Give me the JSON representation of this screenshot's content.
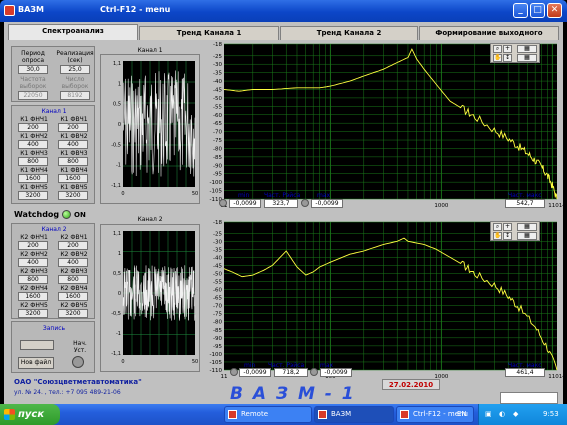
{
  "window": {
    "app_title": "ВАЗМ",
    "menu_text": "Ctrl-F12 - menu",
    "minimize": "_",
    "maximize": "□",
    "close": "✕"
  },
  "tabs": [
    {
      "label": "Спектроанализ",
      "active": true
    },
    {
      "label": "Тренд Канала 1",
      "active": false
    },
    {
      "label": "Тренд Канала 2",
      "active": false
    },
    {
      "label": "Формирование выходного сигнала",
      "active": false
    }
  ],
  "params": {
    "period_label": "Период опроса",
    "period_value": "30,0",
    "realization_label": "Реализация (сек)",
    "realization_value": "25,0",
    "freq_label": "Частота выборок",
    "freq_value": "22050",
    "count_label": "Число выборок",
    "count_value": "8192"
  },
  "channel1": {
    "title": "Канал 1",
    "filters": [
      {
        "label": "К1 ФНЧ1",
        "value": "200"
      },
      {
        "label": "К1 ФВЧ1",
        "value": "200"
      },
      {
        "label": "К1 ФНЧ2",
        "value": "400"
      },
      {
        "label": "К1 ФВЧ2",
        "value": "400"
      },
      {
        "label": "К1 ФНЧ3",
        "value": "800"
      },
      {
        "label": "К1 ФВЧ3",
        "value": "800"
      },
      {
        "label": "К1 ФНЧ4",
        "value": "1600"
      },
      {
        "label": "К1 ФВЧ4",
        "value": "1600"
      },
      {
        "label": "К1 ФНЧ5",
        "value": "3200"
      },
      {
        "label": "К1 ФВЧ5",
        "value": "3200"
      }
    ]
  },
  "channel2": {
    "title": "Канал 2",
    "filters": [
      {
        "label": "К2 ФНЧ1",
        "value": "200"
      },
      {
        "label": "К2 ФВЧ1",
        "value": "200"
      },
      {
        "label": "К2 ФНЧ2",
        "value": "400"
      },
      {
        "label": "К2 ФВЧ2",
        "value": "400"
      },
      {
        "label": "К2 ФНЧ3",
        "value": "800"
      },
      {
        "label": "К2 ФВЧ3",
        "value": "800"
      },
      {
        "label": "К2 ФНЧ4",
        "value": "1600"
      },
      {
        "label": "К2 ФВЧ4",
        "value": "1600"
      },
      {
        "label": "К2 ФНЧ5",
        "value": "3200"
      },
      {
        "label": "К2 ФВЧ5",
        "value": "3200"
      }
    ]
  },
  "watchdog": {
    "label": "Watchdog",
    "state": "ON"
  },
  "record": {
    "title": "Запись",
    "new_file": "Нов файл",
    "start_label": "Нач. Уст."
  },
  "scope1": {
    "title": "Канал 1",
    "y_ticks": [
      "1,1",
      "1",
      "0,5",
      "0",
      "-0,5",
      "-1",
      "-1,1"
    ],
    "x_ticks": [
      "0",
      "50"
    ]
  },
  "scope2": {
    "title": "Канал 2",
    "y_ticks": [
      "1,1",
      "1",
      "0,5",
      "0",
      "-0,5",
      "-1",
      "-1,1"
    ],
    "x_ticks": [
      "0",
      "50"
    ]
  },
  "spectrum1": {
    "min_label": "min",
    "min_value": "-0,0099",
    "rays_label": "Част. Рэйса",
    "rays_value": "323,7",
    "max_label": "max",
    "max_value": "-0,0099",
    "max_freq_label": "Част. макс",
    "max_freq_value": "542,7",
    "x_ticks": [
      "11",
      "100",
      "1000",
      "11014"
    ]
  },
  "spectrum2": {
    "min_label": "min",
    "min_value": "-0,0099",
    "rays_label": "Част. Рэйса",
    "rays_value": "718,2",
    "max_label": "max",
    "max_value": "-0,0099",
    "max_freq_label": "Част. макс",
    "max_freq_value": "461,4",
    "x_ticks": [
      "11",
      "100",
      "1000",
      "11014"
    ]
  },
  "chart_data": [
    {
      "type": "line",
      "title": "",
      "xlabel": "",
      "ylabel": "",
      "x_scale": "log",
      "xlim": [
        11,
        11014
      ],
      "ylim": [
        -110,
        -18
      ],
      "y_ticks": [
        -18,
        -25,
        -30,
        -35,
        -40,
        -45,
        -50,
        -55,
        -60,
        -65,
        -70,
        -75,
        -80,
        -85,
        -90,
        -95,
        -100,
        -105,
        -110
      ],
      "x_tick_labels": [
        "11",
        "100",
        "1000",
        "11014"
      ],
      "grid": true,
      "series": [
        {
          "color": "#ffff40",
          "x": [
            11,
            15,
            20,
            30,
            50,
            80,
            100,
            150,
            200,
            300,
            400,
            500,
            543,
            600,
            700,
            900,
            1200,
            1600,
            2000,
            3000,
            4000,
            5000,
            6000,
            7000,
            8000,
            9000,
            10000,
            11014
          ],
          "y": [
            -45,
            -46,
            -45,
            -45,
            -44,
            -44,
            -43,
            -40,
            -37,
            -33,
            -29,
            -26,
            -21,
            -27,
            -33,
            -42,
            -52,
            -57,
            -61,
            -69,
            -74,
            -79,
            -83,
            -87,
            -91,
            -96,
            -102,
            -110
          ]
        }
      ]
    },
    {
      "type": "line",
      "title": "",
      "xlabel": "",
      "ylabel": "",
      "x_scale": "log",
      "xlim": [
        11,
        11014
      ],
      "ylim": [
        -110,
        -18
      ],
      "y_ticks": [
        -18,
        -25,
        -30,
        -35,
        -40,
        -45,
        -50,
        -55,
        -60,
        -65,
        -70,
        -75,
        -80,
        -85,
        -90,
        -95,
        -100,
        -105,
        -110
      ],
      "x_tick_labels": [
        "11",
        "100",
        "1000",
        "11014"
      ],
      "grid": true,
      "series": [
        {
          "color": "#ffff40",
          "x": [
            11,
            13,
            16,
            20,
            25,
            30,
            40,
            50,
            60,
            70,
            80,
            100,
            150,
            200,
            300,
            400,
            461,
            500,
            700,
            900,
            1200,
            1600,
            2000,
            3000,
            4000,
            5000,
            7000,
            9000,
            11014
          ],
          "y": [
            -47,
            -49,
            -52,
            -51,
            -48,
            -45,
            -36,
            -46,
            -51,
            -49,
            -46,
            -43,
            -38,
            -36,
            -32,
            -30,
            -28,
            -30,
            -32,
            -35,
            -40,
            -45,
            -50,
            -57,
            -64,
            -71,
            -83,
            -96,
            -110
          ]
        }
      ]
    }
  ],
  "footer": {
    "company": "ОАО \"Союзцветметавтоматика\"",
    "address": "ул. № 24. , тел.: +7 095 489-21-06",
    "big_title": "В А З М - 1",
    "date": "27.02.2010"
  },
  "taskbar": {
    "start": "пуск",
    "items": [
      {
        "label": "Remote Administrator",
        "active": false
      },
      {
        "label": "ВАЗМ",
        "active": true
      },
      {
        "label": "Ctrl-F12 - menu",
        "active": false
      }
    ],
    "lang": "EN",
    "clock": "9:53"
  },
  "colors": {
    "trace": "#ffff40",
    "grid": "#1a7a1a",
    "scope_grid": "#1f8f3f",
    "label_blue": "#0000c0"
  }
}
